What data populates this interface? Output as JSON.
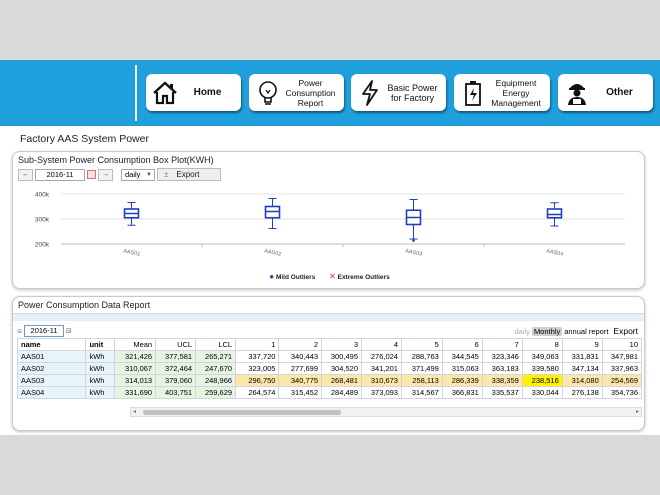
{
  "nav": {
    "items": [
      {
        "label": "Home"
      },
      {
        "label": "Power\nConsumption\nReport"
      },
      {
        "label": "Basic  Power\nfor Factory"
      },
      {
        "label": "Equipment\nEnergy\nManagement"
      },
      {
        "label": "Other"
      }
    ]
  },
  "page": {
    "title": "Factory AAS System Power"
  },
  "chart_panel": {
    "title": "Sub-System Power Consumption Box Plot(KWH)",
    "prev": "←",
    "next": "→",
    "date": "2016-11",
    "period": "daily",
    "export": "Export",
    "legend": {
      "mild": "Mild Outliers",
      "extreme": "Extreme Outliers"
    }
  },
  "colors": {
    "accent": "#1fa0dc",
    "box": "#1f3fbf",
    "mild": "#1f3fbf",
    "extreme": "#e03030"
  },
  "chart_data": {
    "type": "box",
    "title": "Sub-System Power Consumption Box Plot(KWH)",
    "categories": [
      "AAS01",
      "AAS02",
      "AAS03",
      "AAS04"
    ],
    "yticks": [
      "400k",
      "300k",
      "200k"
    ],
    "ylim": [
      200000,
      400000
    ],
    "boxes": [
      {
        "whisker_low": 275000,
        "q1": 305000,
        "median": 322000,
        "q3": 340000,
        "whisker_high": 366000
      },
      {
        "whisker_low": 262000,
        "q1": 305000,
        "median": 330000,
        "q3": 350000,
        "whisker_high": 382000
      },
      {
        "whisker_low": 220000,
        "q1": 278000,
        "median": 306000,
        "q3": 335000,
        "whisker_high": 378000
      },
      {
        "whisker_low": 272000,
        "q1": 305000,
        "median": 318000,
        "q3": 340000,
        "whisker_high": 365000
      }
    ],
    "mild_outliers": [
      {
        "category": "AAS03",
        "value": 214000
      }
    ],
    "legend": [
      "Mild Outliers",
      "Extreme Outliers"
    ],
    "grid": true
  },
  "report": {
    "title": "Power Consumption Data Report",
    "date": "2016-11",
    "views": [
      "daily",
      "Monthly",
      "annual report"
    ],
    "active_view": "Monthly",
    "export": "Export",
    "headers": [
      "name",
      "unit",
      "Mean",
      "UCL",
      "LCL",
      "1",
      "2",
      "3",
      "4",
      "5",
      "6",
      "7",
      "8",
      "9",
      "10"
    ],
    "rows": [
      {
        "name": "AAS01",
        "unit": "kWh",
        "values": [
          "321,426",
          "377,581",
          "265,271",
          "337,720",
          "340,443",
          "300,495",
          "276,024",
          "288,763",
          "344,545",
          "323,346",
          "349,063",
          "331,831",
          "347,981"
        ]
      },
      {
        "name": "AAS02",
        "unit": "kWh",
        "values": [
          "310,067",
          "372,464",
          "247,670",
          "323,005",
          "277,699",
          "304,520",
          "341,201",
          "371,499",
          "315,063",
          "363,183",
          "339,580",
          "347,134",
          "337,963"
        ]
      },
      {
        "name": "AAS03",
        "unit": "kWh",
        "values": [
          "314,013",
          "379,060",
          "248,966",
          "296,750",
          "340,775",
          "268,481",
          "310,673",
          "258,113",
          "286,339",
          "338,359",
          "238,516",
          "314,080",
          "254,569"
        ]
      },
      {
        "name": "AAS04",
        "unit": "kWh",
        "values": [
          "331,690",
          "403,751",
          "259,629",
          "264,574",
          "315,452",
          "284,489",
          "373,093",
          "314,567",
          "366,831",
          "335,537",
          "330,044",
          "276,138",
          "354,736"
        ]
      }
    ]
  }
}
